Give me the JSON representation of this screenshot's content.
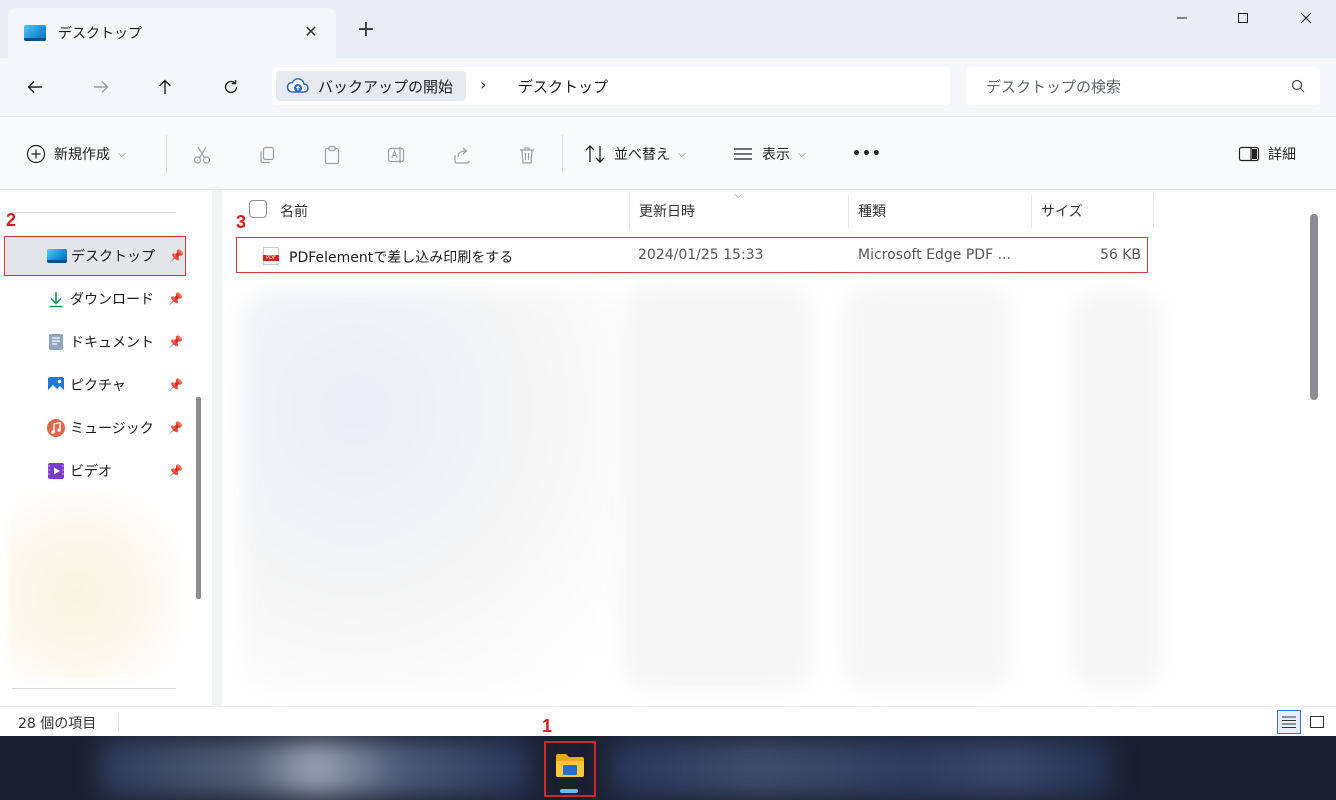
{
  "window": {
    "tab_title": "デスクトップ",
    "new_tab_label": "+",
    "close_tab_label": "✕"
  },
  "address": {
    "root_label": "バックアップの開始",
    "separator": "›",
    "current": "デスクトップ",
    "search_placeholder": "デスクトップの検索"
  },
  "toolbar": {
    "new_label": "新規作成",
    "sort_label": "並べ替え",
    "view_label": "表示",
    "more_label": "•••",
    "details_label": "詳細"
  },
  "sidebar": {
    "items": [
      {
        "label": "デスクトップ",
        "icon": "desktop-icon",
        "selected": true
      },
      {
        "label": "ダウンロード",
        "icon": "download-icon"
      },
      {
        "label": "ドキュメント",
        "icon": "document-icon"
      },
      {
        "label": "ピクチャ",
        "icon": "picture-icon"
      },
      {
        "label": "ミュージック",
        "icon": "music-icon"
      },
      {
        "label": "ビデオ",
        "icon": "video-icon"
      }
    ]
  },
  "file_list": {
    "columns": [
      "名前",
      "更新日時",
      "種類",
      "サイズ"
    ],
    "rows": [
      {
        "name": "PDFelementで差し込み印刷をする",
        "modified": "2024/01/25 15:33",
        "type": "Microsoft Edge PDF ...",
        "size": "56 KB",
        "icon": "pdf-file-icon"
      }
    ]
  },
  "status": {
    "item_count": "28 個の項目"
  },
  "callouts": {
    "one": "1",
    "two": "2",
    "three": "3"
  },
  "colors": {
    "highlight": "#d53a3a",
    "accent": "#1b8fd8"
  }
}
